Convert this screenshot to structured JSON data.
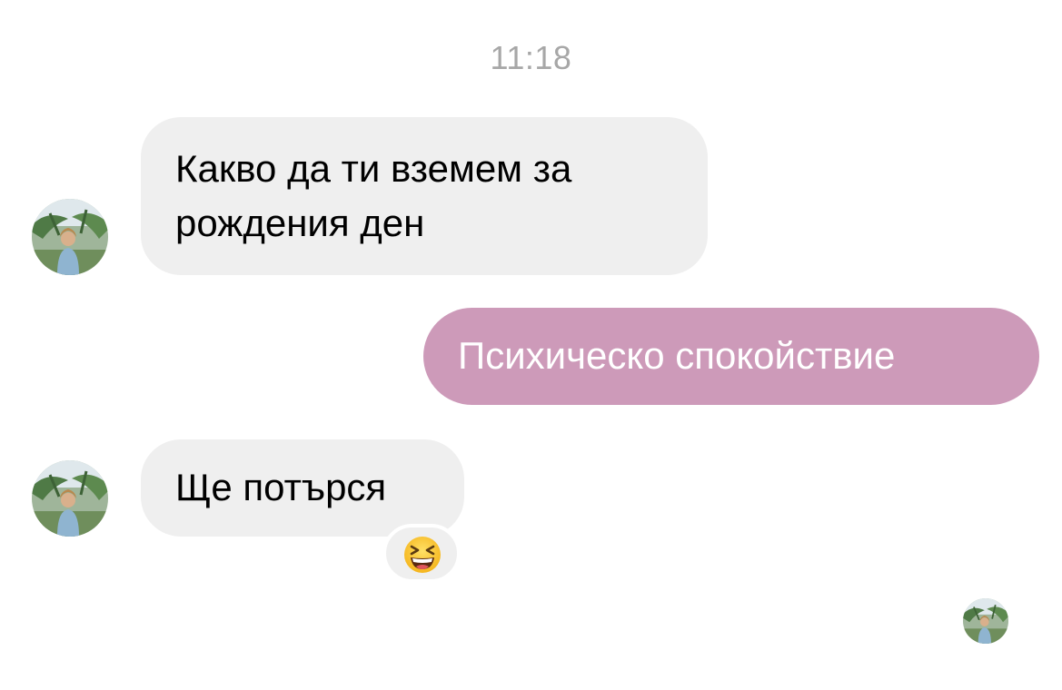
{
  "conversation": {
    "timestamp": "11:18",
    "messages": [
      {
        "direction": "incoming",
        "text": "Какво да ти вземем за рождения ден"
      },
      {
        "direction": "outgoing",
        "text": "Психическо спокойствие"
      },
      {
        "direction": "incoming",
        "text": "Ще потърся",
        "reaction": "😆"
      }
    ],
    "avatar_icon": "contact-avatar-photo",
    "read_receipt_icon": "seen-avatar-photo",
    "reaction_icon": "grinning-squinting-face-icon"
  },
  "colors": {
    "incoming_bubble": "#efefef",
    "outgoing_bubble": "#cd9ab9",
    "timestamp": "#a7a7a7",
    "background": "#ffffff"
  }
}
